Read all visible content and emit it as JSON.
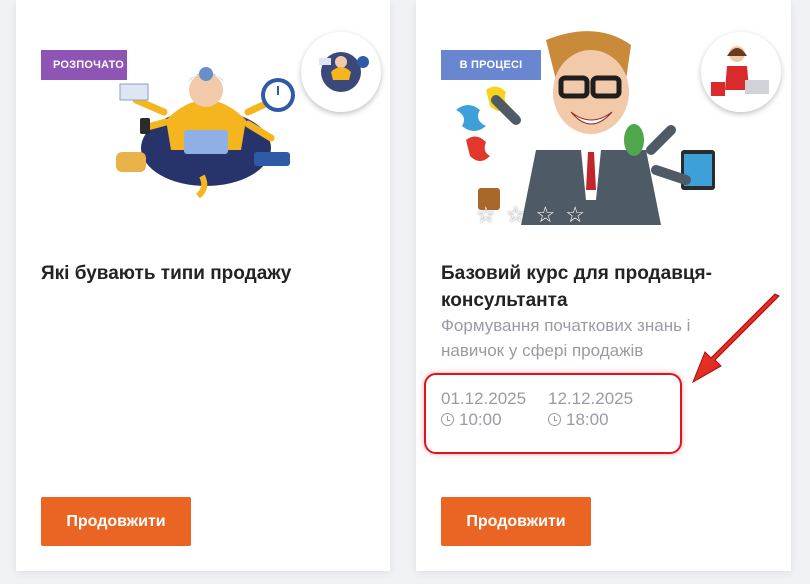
{
  "courses": [
    {
      "status_badge": "РОЗПОЧАТО",
      "title": "Які бувають типи продажу",
      "subtitle": "",
      "button_label": "Продовжити",
      "colors": {
        "badge": "#8e55b5",
        "button": "#ea6523"
      }
    },
    {
      "status_badge": "В ПРОЦЕСІ",
      "title": "Базовий курс для продавця-консультанта",
      "subtitle": "Формування початкових знань і навичок у сфері продажів",
      "start_date": "01.12.2025",
      "start_time": "10:00",
      "end_date": "12.12.2025",
      "end_time": "18:00",
      "button_label": "Продовжити",
      "rating_icons": [
        "star-outline-icon",
        "star-outline-icon",
        "star-outline-icon",
        "star-outline-icon"
      ],
      "colors": {
        "badge": "#6a86d1",
        "button": "#ea6523"
      }
    }
  ],
  "annotation": {
    "highlight_color": "#e2141a",
    "arrow_icon": "red-arrow-icon"
  }
}
